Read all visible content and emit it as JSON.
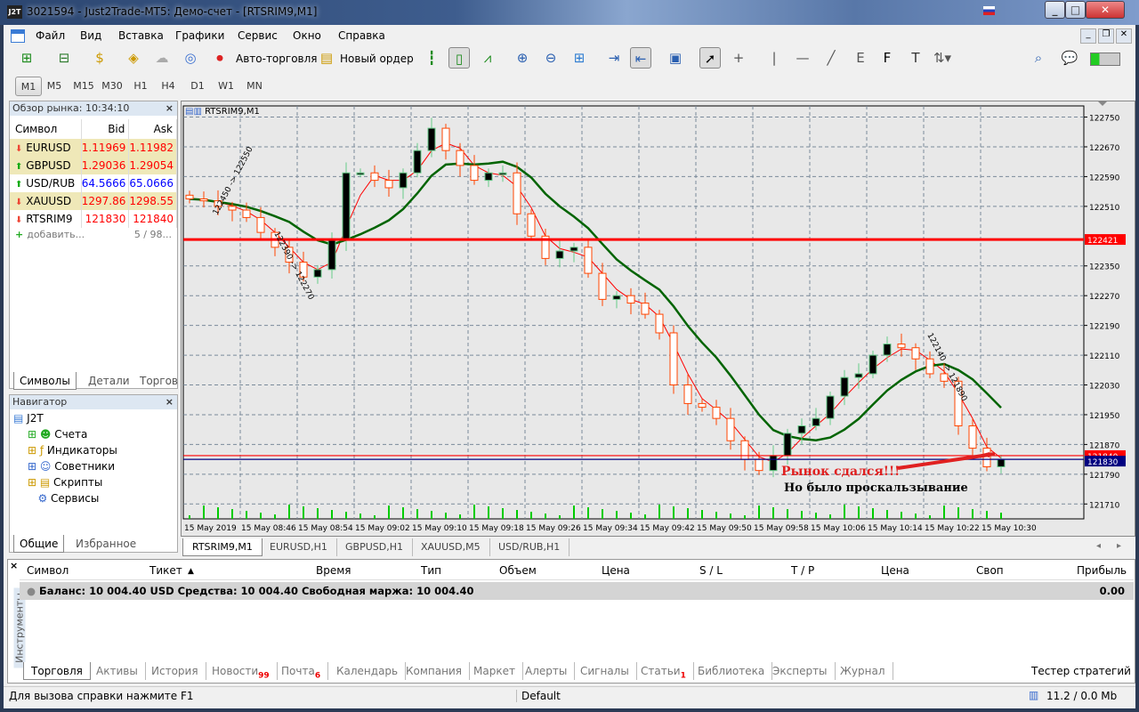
{
  "window": {
    "logo": "J2T",
    "title": "3021594 - Just2Trade-MT5: Демо-счет - [RTSRIM9,M1]",
    "flag": "ru-flag-icon"
  },
  "menu": [
    "Файл",
    "Вид",
    "Вставка",
    "Графики",
    "Сервис",
    "Окно",
    "Справка"
  ],
  "toolbar": {
    "autotrade": "Авто-торговля",
    "new_order": "Новый ордер"
  },
  "timeframes": [
    "M1",
    "M5",
    "M15",
    "M30",
    "H1",
    "H4",
    "D1",
    "W1",
    "MN"
  ],
  "timeframe_selected": "M1",
  "market_watch": {
    "title": "Обзор рынка: 10:34:10",
    "headers": [
      "Символ",
      "Bid",
      "Ask"
    ],
    "rows": [
      {
        "symbol": "EURUSD",
        "bid": "1.11969",
        "ask": "1.11982",
        "dir": "down",
        "color": "red",
        "hl": true
      },
      {
        "symbol": "GBPUSD",
        "bid": "1.29036",
        "ask": "1.29054",
        "dir": "up",
        "color": "red",
        "hl": true
      },
      {
        "symbol": "USD/RUB",
        "bid": "64.5666",
        "ask": "65.0666",
        "dir": "up",
        "color": "blue",
        "hl": false
      },
      {
        "symbol": "XAUUSD",
        "bid": "1297.86",
        "ask": "1298.55",
        "dir": "down",
        "color": "red",
        "hl": true
      },
      {
        "symbol": "RTSRIM9",
        "bid": "121830",
        "ask": "121840",
        "dir": "down",
        "color": "red",
        "hl": false
      }
    ],
    "add": "добавить...",
    "count": "5 / 98...",
    "tabs": [
      "Символы",
      "Детали",
      "Торгов"
    ]
  },
  "navigator": {
    "title": "Навигатор",
    "root": "J2T",
    "items": [
      "Счета",
      "Индикаторы",
      "Советники",
      "Скрипты",
      "Сервисы"
    ],
    "tabs": [
      "Общие",
      "Избранное"
    ]
  },
  "chart_data": {
    "type": "candlestick",
    "title": "RTSRIM9,M1",
    "ylim": [
      121670,
      122780
    ],
    "yticks": [
      122750,
      122670,
      122590,
      122510,
      122350,
      122270,
      122190,
      122110,
      122030,
      121950,
      121870,
      121790,
      121710
    ],
    "xticks": [
      "15 May 2019",
      "15 May 08:46",
      "15 May 08:54",
      "15 May 09:02",
      "15 May 09:10",
      "15 May 09:18",
      "15 May 09:26",
      "15 May 09:34",
      "15 May 09:42",
      "15 May 09:50",
      "15 May 09:58",
      "15 May 10:06",
      "15 May 10:14",
      "15 May 10:22",
      "15 May 10:30"
    ],
    "closes": [
      122530,
      122525,
      122510,
      122500,
      122480,
      122440,
      122400,
      122360,
      122320,
      122340,
      122420,
      122600,
      122600,
      122580,
      122560,
      122600,
      122660,
      122720,
      122660,
      122620,
      122580,
      122600,
      122600,
      122490,
      122430,
      122370,
      122390,
      122400,
      122330,
      122260,
      122270,
      122250,
      122220,
      122170,
      122030,
      121980,
      121970,
      121940,
      121880,
      121830,
      121800,
      121840,
      121900,
      121920,
      121940,
      122000,
      122050,
      122060,
      122110,
      122140,
      122130,
      122100,
      122060,
      122040,
      121920,
      121860,
      121810,
      121830
    ],
    "indicators": [
      {
        "type": "MA",
        "color": "#ff0000"
      },
      {
        "type": "MA",
        "color": "#006400"
      }
    ],
    "levels": [
      {
        "price": 122421,
        "label": "122421",
        "color": "#ff0000"
      },
      {
        "price": 121840,
        "label": "121840",
        "color": "#ff0000"
      },
      {
        "price": 121830,
        "label": "121830",
        "color": "#000080"
      }
    ],
    "trade_labels": [
      "122450 -> 122550",
      "122390 -> 122270",
      "122140 -> 121890"
    ],
    "annotations": {
      "line1": "Рынок  сдался!!!",
      "line2": "Но было проскальзывание"
    },
    "colors": {
      "bull_body": "#000000",
      "bull_outline": "#66cc88",
      "bear_body": "#ffffff",
      "bear_outline": "#ff4500",
      "volume": "#00cc00",
      "grid": "#7a8a9a"
    }
  },
  "chart_tabs": [
    "RTSRIM9,M1",
    "EURUSD,H1",
    "GBPUSD,H1",
    "XAUUSD,M5",
    "USD/RUB,H1"
  ],
  "terminal": {
    "side_label": "Инструменты",
    "headers": [
      "Символ",
      "Тикет",
      "Время",
      "Тип",
      "Объем",
      "Цена",
      "S / L",
      "T / P",
      "Цена",
      "Своп",
      "Прибыль"
    ],
    "balance": "Баланс: 10 004.40 USD  Средства: 10 004.40  Свободная маржа: 10 004.40",
    "profit": "0.00",
    "tabs": [
      {
        "label": "Торговля"
      },
      {
        "label": "Активы"
      },
      {
        "label": "История"
      },
      {
        "label": "Новости",
        "badge": "99"
      },
      {
        "label": "Почта",
        "badge": "6"
      },
      {
        "label": "Календарь"
      },
      {
        "label": "Компания"
      },
      {
        "label": "Маркет"
      },
      {
        "label": "Алерты"
      },
      {
        "label": "Сигналы"
      },
      {
        "label": "Статьи",
        "badge": "1"
      },
      {
        "label": "Библиотека"
      },
      {
        "label": "Эксперты"
      },
      {
        "label": "Журнал"
      }
    ],
    "tester": "Тестер стратегий"
  },
  "status": {
    "help": "Для вызова справки нажмите F1",
    "profile": "Default",
    "traffic": "11.2 / 0.0 Mb"
  }
}
